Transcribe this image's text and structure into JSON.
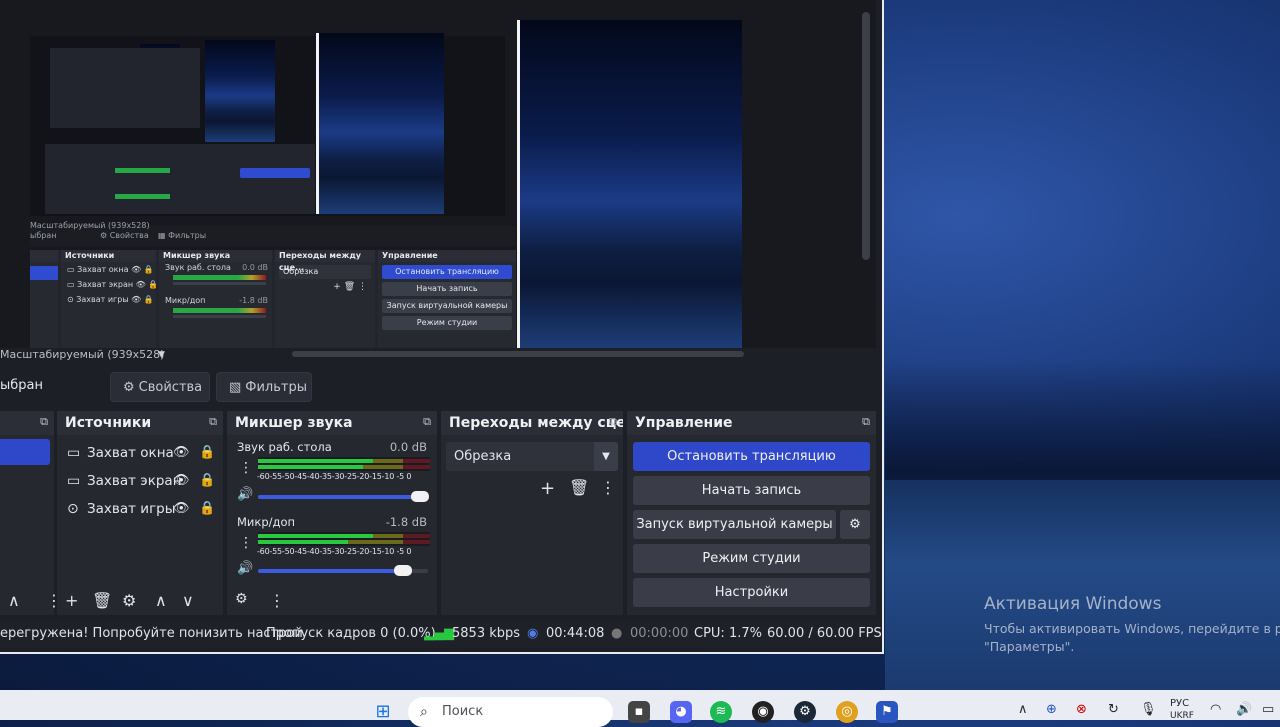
{
  "desktop": {
    "activation_title": "Активация Windows",
    "activation_line1": "Чтобы активировать Windows, перейдите в раз",
    "activation_line2": "\"Параметры\"."
  },
  "preview": {
    "scale_label": "Масштабируемый (939x528)",
    "mini": {
      "scale_label": "Масштабируемый (939x528)",
      "toolbar_label": "ыбран",
      "properties": "Свойства",
      "filters": "Фильтры",
      "sources_title": "Источники",
      "mixer_title": "Микшер звука",
      "transitions_title": "Переходы между сце...",
      "controls_title": "Управление",
      "sources": [
        "Захват окна",
        "Захват экран",
        "Захват игры"
      ],
      "mixer_desktop": "Звук раб. стола",
      "mixer_desktop_db": "0.0 dB",
      "mixer_mic": "Микр/доп",
      "mixer_mic_db": "-1.8 dB",
      "transition": "Обрезка",
      "btn_stop": "Остановить трансляцию",
      "btn_record": "Начать запись",
      "btn_vcam": "Запуск виртуальной камеры",
      "btn_studio": "Режим студии"
    }
  },
  "toolbar": {
    "no_source_label": "ыбран",
    "properties_label": "Свойства",
    "filters_label": "Фильтры"
  },
  "docks": {
    "sources": {
      "title": "Источники",
      "items": [
        {
          "label": "Захват окна",
          "icon": "window-icon"
        },
        {
          "label": "Захват экран",
          "icon": "monitor-icon"
        },
        {
          "label": "Захват игры",
          "icon": "gamepad-icon"
        }
      ]
    },
    "mixer": {
      "title": "Микшер звука",
      "channels": [
        {
          "name": "Звук раб. стола",
          "db": "0.0 dB",
          "volume": 0.95
        },
        {
          "name": "Микр/доп",
          "db": "-1.8 dB",
          "volume": 0.85
        }
      ],
      "ticks": "-60-55-50-45-40-35-30-25-20-15-10 -5  0"
    },
    "transitions": {
      "title": "Переходы между сце...",
      "selected": "Обрезка"
    },
    "controls": {
      "title": "Управление",
      "stop_stream": "Остановить трансляцию",
      "start_recording": "Начать запись",
      "start_vcam": "Запуск виртуальной камеры",
      "studio_mode": "Режим студии",
      "settings": "Настройки"
    }
  },
  "statusbar": {
    "warning": "ерегружена! Попробуйте понизить настрой",
    "dropped_frames": "Пропуск кадров 0 (0.0%)",
    "bitrate": "5853 kbps",
    "stream_time": "00:44:08",
    "record_time": "00:00:00",
    "cpu": "CPU: 1.7%",
    "fps": "60.00 / 60.00 FPS"
  },
  "taskbar": {
    "search_placeholder": "Поиск",
    "lang": "РУС",
    "lang2": "UKRF"
  },
  "colors": {
    "accent": "#2f47c9",
    "meter_green": "#28c840",
    "meter_yellow": "#b8a428",
    "meter_red": "#8e1a22",
    "window_bg": "#1d1f26"
  }
}
